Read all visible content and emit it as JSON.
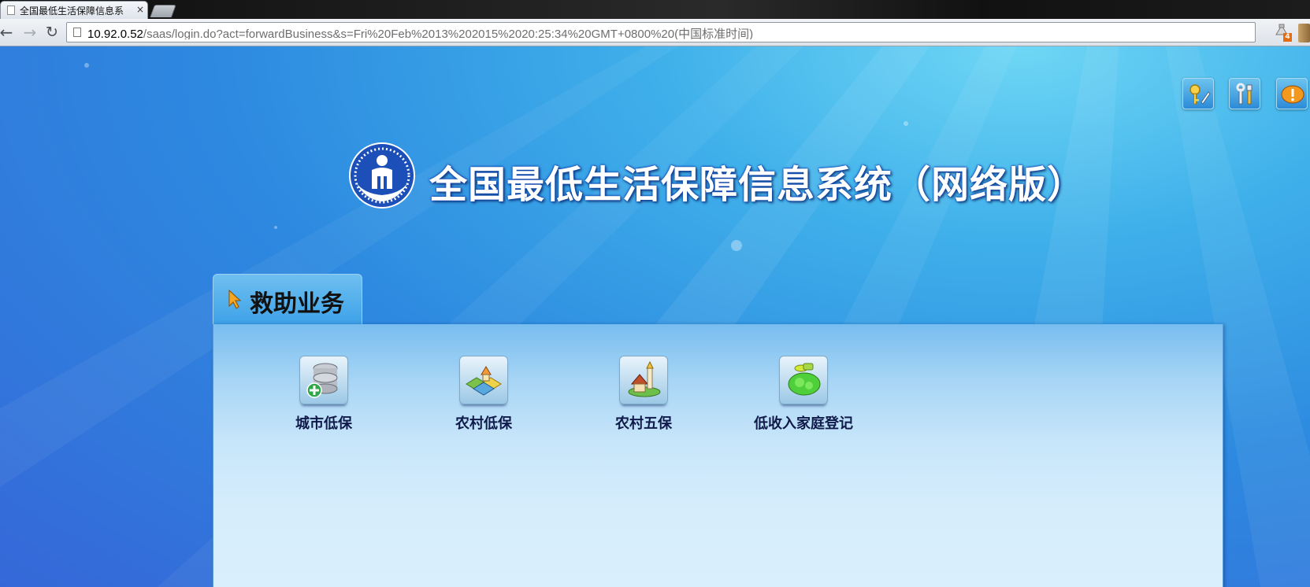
{
  "browser": {
    "tab_title": "全国最低生活保障信息系",
    "tab_close": "×",
    "url_host": "10.92.0.52",
    "url_rest": "/saas/login.do?act=forwardBusiness&s=Fri%20Feb%2013%202015%2020:25:34%20GMT+0800%20(中国标准时间)",
    "help_label": "?",
    "star_label": "☆",
    "back_label": "←",
    "forward_label": "→",
    "reload_label": "↻",
    "extension_badge": "4"
  },
  "header": {
    "title": "全国最低生活保障信息系统（网络版）",
    "tools": [
      "key-edit-icon",
      "tools-icon",
      "info-icon"
    ]
  },
  "section": {
    "tab_label": "救助业务"
  },
  "modules": [
    {
      "label": "城市低保",
      "icon": "database-add-icon"
    },
    {
      "label": "农村低保",
      "icon": "rural-map-icon"
    },
    {
      "label": "农村五保",
      "icon": "village-icon"
    },
    {
      "label": "低收入家庭登记",
      "icon": "family-registration-icon"
    }
  ],
  "colors": {
    "page_blue": "#2e8ae0",
    "panel_light": "#d9effd",
    "module_text": "#101a4a"
  }
}
